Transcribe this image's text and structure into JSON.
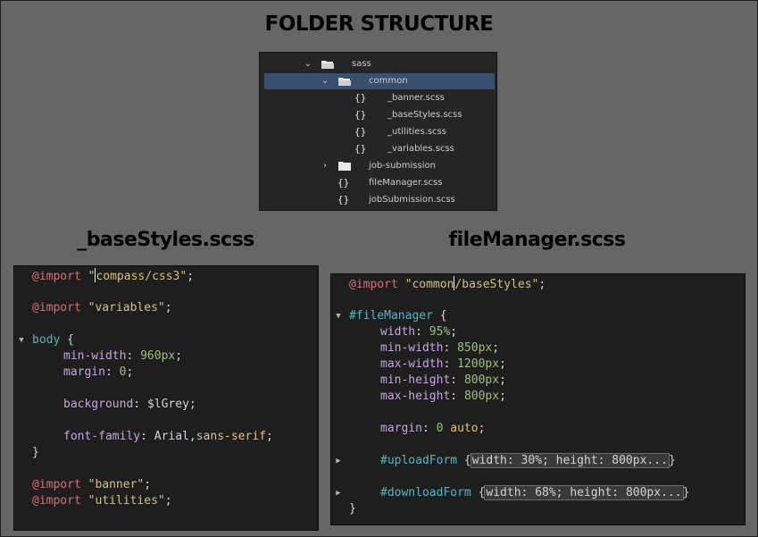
{
  "headings": {
    "folder_structure": "FOLDER STRUCTURE",
    "base_styles": "_baseStyles.scss",
    "file_manager": "fileManager.scss"
  },
  "tree": {
    "items": [
      {
        "label": "sass",
        "type": "folder",
        "expanded": true
      },
      {
        "label": "common",
        "type": "folder",
        "expanded": true,
        "selected": true
      },
      {
        "label": "_banner.scss",
        "type": "file"
      },
      {
        "label": "_baseStyles.scss",
        "type": "file"
      },
      {
        "label": "_utilities.scss",
        "type": "file"
      },
      {
        "label": "_variables.scss",
        "type": "file"
      },
      {
        "label": "job-submission",
        "type": "folder",
        "expanded": false
      },
      {
        "label": "fileManager.scss",
        "type": "file"
      },
      {
        "label": "jobSubmission.scss",
        "type": "file"
      }
    ],
    "file_icon_glyph": "{}",
    "selection_color": "#37506e"
  },
  "base_code": {
    "import1_kw": "@import",
    "import1_q": "\"",
    "import1_val": "compass/css3\"",
    "semi": ";",
    "import2_kw": "@import",
    "import2_val": "\"variables\"",
    "body_sel": "body",
    "open_brace": "{",
    "close_brace": "}",
    "minwidth_prop": "min-width",
    "minwidth_val": "960px",
    "margin_prop": "margin",
    "margin_val": "0",
    "bg_prop": "background",
    "bg_val": "$lGrey",
    "font_prop": "font-family",
    "font_val1": "Arial",
    "font_comma": ",",
    "font_val2": "sans-serif",
    "import3_kw": "@import",
    "import3_val": "\"banner\"",
    "import4_kw": "@import",
    "import4_val": "\"utilities\""
  },
  "file_code": {
    "import_kw": "@import",
    "import_val1": "\"common",
    "import_val2": "/baseStyles\"",
    "semi": ";",
    "fm_sel": "#fileManager",
    "open_brace": "{",
    "close_brace": "}",
    "width_prop": "width",
    "width_val": "95%",
    "minwidth_prop": "min-width",
    "minwidth_val": "850px",
    "maxwidth_prop": "max-width",
    "maxwidth_val": "1200px",
    "minheight_prop": "min-height",
    "minheight_val": "800px",
    "maxheight_prop": "max-height",
    "maxheight_val": "800px",
    "margin_prop": "margin",
    "margin_val1": "0",
    "margin_val2": "auto",
    "upload_sel": "#uploadForm",
    "upload_collapsed": "width: 30%; height: 800px...",
    "download_sel": "#downloadForm",
    "download_collapsed": "width: 68%; height: 800px..."
  },
  "glyphs": {
    "fold_open": "▼",
    "fold_closed": "▶",
    "tree_open": "⌄",
    "tree_closed": "›",
    "colon": ":",
    "space_colon": ": "
  }
}
